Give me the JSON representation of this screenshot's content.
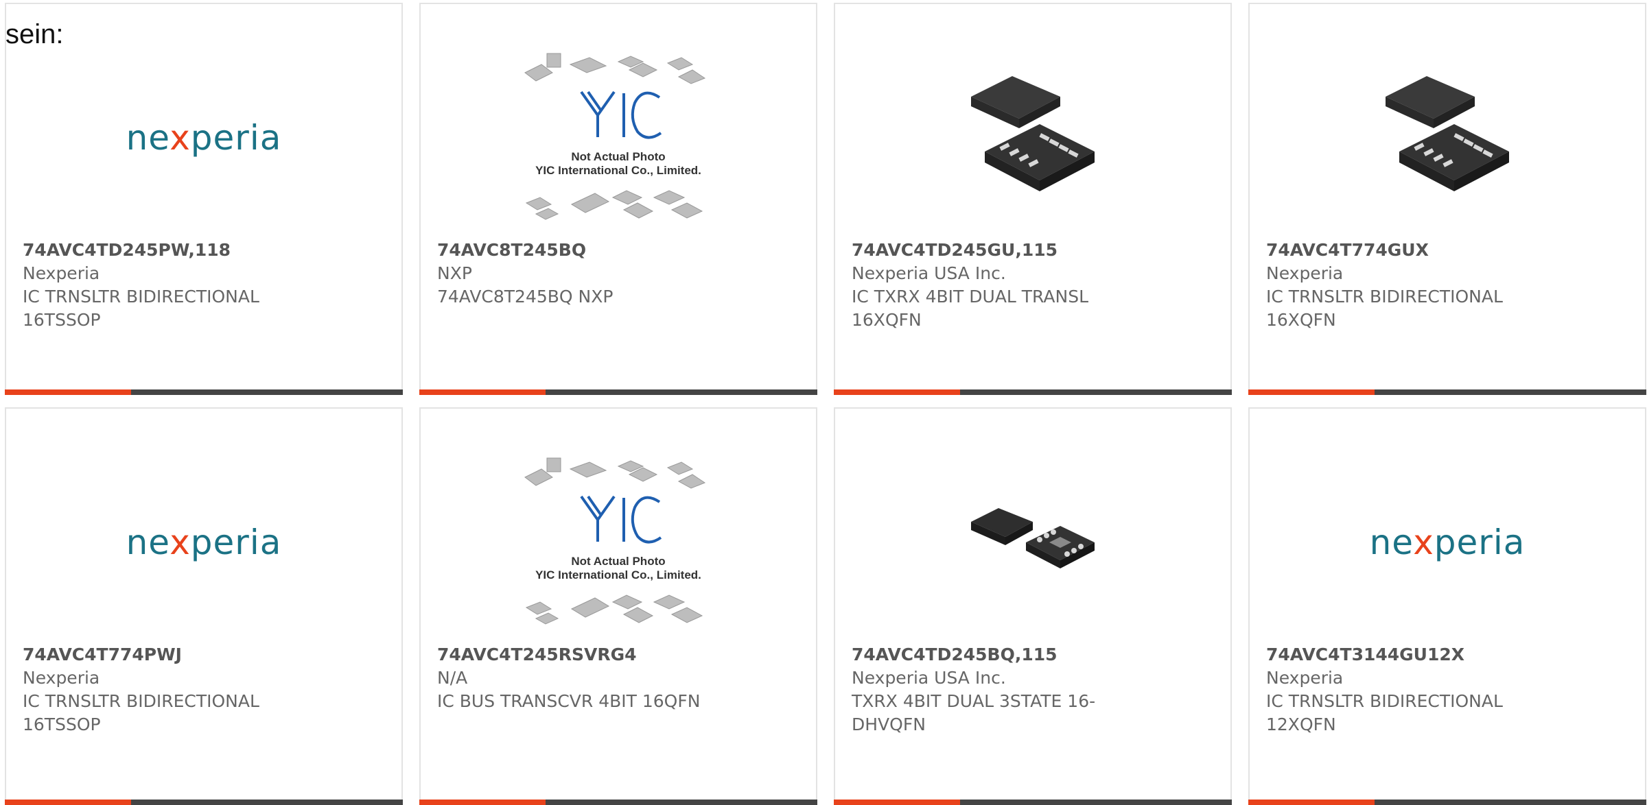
{
  "heading": "sein:",
  "placeholder": {
    "logo_text": "YIC",
    "line1": "Not Actual Photo",
    "line2": "YIC International Co., Limited."
  },
  "brand": {
    "nexperia_pre": "ne",
    "nexperia_x": "x",
    "nexperia_post": "peria"
  },
  "colors": {
    "accent": "#e8421b",
    "bar_dark": "#444444",
    "nexperia_teal": "#1b7285"
  },
  "products": [
    {
      "part": "74AVC4TD245PW,118",
      "maker": "Nexperia",
      "desc": "IC TRNSLTR BIDIRECTIONAL",
      "desc2": "16TSSOP",
      "image": "nexperia-logo"
    },
    {
      "part": "74AVC8T245BQ",
      "maker": "NXP",
      "desc": "74AVC8T245BQ NXP",
      "desc2": "",
      "image": "yic-placeholder"
    },
    {
      "part": "74AVC4TD245GU,115",
      "maker": "Nexperia USA Inc.",
      "desc": "IC TXRX 4BIT DUAL TRANSL",
      "desc2": "16XQFN",
      "image": "chip-pair-large"
    },
    {
      "part": "74AVC4T774GUX",
      "maker": "Nexperia",
      "desc": "IC TRNSLTR BIDIRECTIONAL",
      "desc2": "16XQFN",
      "image": "chip-pair-large"
    },
    {
      "part": "74AVC4T774PWJ",
      "maker": "Nexperia",
      "desc": "IC TRNSLTR BIDIRECTIONAL",
      "desc2": "16TSSOP",
      "image": "nexperia-logo"
    },
    {
      "part": "74AVC4T245RSVRG4",
      "maker": "N/A",
      "desc": "IC BUS TRANSCVR 4BIT 16QFN",
      "desc2": "",
      "image": "yic-placeholder"
    },
    {
      "part": "74AVC4TD245BQ,115",
      "maker": "Nexperia USA Inc.",
      "desc": "TXRX 4BIT DUAL 3STATE 16-",
      "desc2": "DHVQFN",
      "image": "chip-pair-small"
    },
    {
      "part": "74AVC4T3144GU12X",
      "maker": "Nexperia",
      "desc": "IC TRNSLTR BIDIRECTIONAL",
      "desc2": "12XQFN",
      "image": "nexperia-logo"
    }
  ]
}
